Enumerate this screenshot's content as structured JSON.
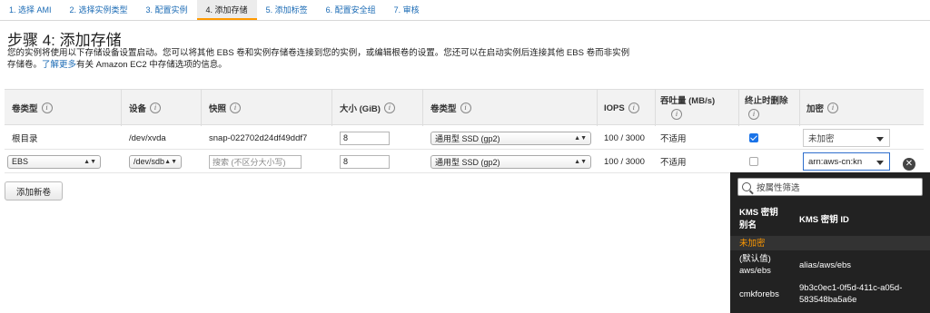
{
  "steps": [
    "1. 选择 AMI",
    "2. 选择实例类型",
    "3. 配置实例",
    "4. 添加存储",
    "5. 添加标签",
    "6. 配置安全组",
    "7. 审核"
  ],
  "page": {
    "title": "步骤 4: 添加存储",
    "desc_line1": "您的实例将使用以下存储设备设置启动。您可以将其他 EBS 卷和实例存储卷连接到您的实例，或编辑根卷的设置。您还可以在启动实例后连接其他 EBS 卷而非实例",
    "desc_line2_pre": "存储卷。",
    "desc_link": "了解更多",
    "desc_line2_post": "有关 Amazon EC2 中存储选项的信息。"
  },
  "table": {
    "headers": {
      "volume_type": "卷类型",
      "device": "设备",
      "snapshot": "快照",
      "size": "大小 (GiB)",
      "vol_kind": "卷类型",
      "iops": "IOPS",
      "throughput": "吞吐量 (MB/s)",
      "delete_on_term": "终止时删除",
      "encryption": "加密"
    },
    "rows": [
      {
        "volume_type": "根目录",
        "device": "/dev/xvda",
        "snapshot": "snap-022702d24df49ddf7",
        "size": "8",
        "vol_kind": "通用型 SSD (gp2)",
        "iops": "100 / 3000",
        "throughput": "不适用",
        "delete_on_term": true,
        "encryption": "未加密"
      },
      {
        "volume_type": "EBS",
        "device": "/dev/sdb",
        "snapshot_placeholder": "搜索 (不区分大小写)",
        "size": "8",
        "vol_kind": "通用型 SSD (gp2)",
        "iops": "100 / 3000",
        "throughput": "不适用",
        "delete_on_term": false,
        "encryption": "arn:aws-cn:kn"
      }
    ]
  },
  "add_button": "添加新卷",
  "kms_dropdown": {
    "search_placeholder": "按属性筛选",
    "col_alias": "KMS 密钥别名",
    "col_id": "KMS 密钥 ID",
    "items": [
      {
        "alias": "未加密",
        "id": ""
      },
      {
        "alias_line1": "(默认值)",
        "alias_line2": "aws/ebs",
        "id": "alias/aws/ebs"
      },
      {
        "alias": "cmkforebs",
        "id_line1": "9b3c0ec1-0f5d-411c-a05d-",
        "id_line2": "583548ba5a6e"
      }
    ]
  },
  "colors": {
    "link": "#1b6bb5",
    "accent": "#ff9900",
    "dropdown_bg": "#222222",
    "selected_item": "#ff9900",
    "checkbox": "#1a73e8"
  }
}
